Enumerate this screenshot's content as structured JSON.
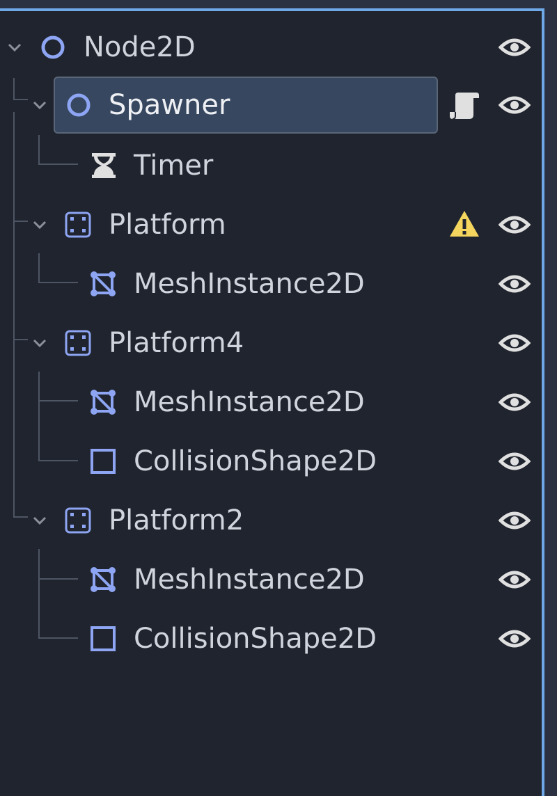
{
  "scene_tree": {
    "accent_color": "#6ea8e6",
    "nodes": [
      {
        "name": "Node2D",
        "icon": "node2d-circle-icon",
        "visible": true
      },
      {
        "name": "Spawner",
        "icon": "node2d-circle-icon",
        "selected": true,
        "has_script": true,
        "visible": true
      },
      {
        "name": "Timer",
        "icon": "hourglass-icon"
      },
      {
        "name": "Platform",
        "icon": "area2d-dotted-rect-icon",
        "warning": true,
        "visible": true
      },
      {
        "name": "MeshInstance2D",
        "icon": "meshinstance2d-icon",
        "visible": true
      },
      {
        "name": "Platform4",
        "icon": "area2d-dotted-rect-icon",
        "visible": true
      },
      {
        "name": "MeshInstance2D",
        "icon": "meshinstance2d-icon",
        "visible": true
      },
      {
        "name": "CollisionShape2D",
        "icon": "collisionshape2d-square-icon",
        "visible": true
      },
      {
        "name": "Platform2",
        "icon": "area2d-dotted-rect-icon",
        "visible": true
      },
      {
        "name": "MeshInstance2D",
        "icon": "meshinstance2d-icon",
        "visible": true
      },
      {
        "name": "CollisionShape2D",
        "icon": "collisionshape2d-square-icon",
        "visible": true
      }
    ]
  }
}
